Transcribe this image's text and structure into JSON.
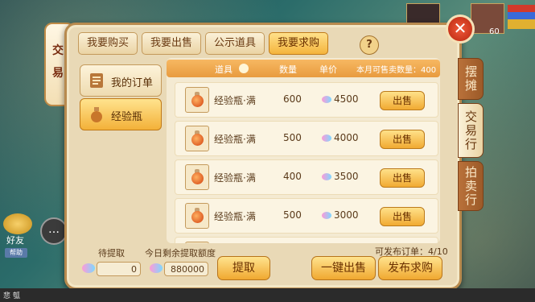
{
  "top_tabs": [
    {
      "label": "我要购买",
      "active": false
    },
    {
      "label": "我要出售",
      "active": false
    },
    {
      "label": "公示道具",
      "active": false
    },
    {
      "label": "我要求购",
      "active": true
    }
  ],
  "help_label": "?",
  "close_label": "✕",
  "side_menu": [
    {
      "label": "我的订单",
      "icon": "order-list-icon",
      "active": false
    },
    {
      "label": "经验瓶",
      "icon": "exp-bottle-icon",
      "active": true
    }
  ],
  "table": {
    "headers": {
      "item": "道具",
      "quantity": "数量",
      "price": "单价",
      "monthly_quota": "本月可售卖数量：400"
    },
    "rows": [
      {
        "name": "经验瓶·满",
        "quantity": "600",
        "price": "4500",
        "action": "出售"
      },
      {
        "name": "经验瓶·满",
        "quantity": "500",
        "price": "4000",
        "action": "出售"
      },
      {
        "name": "经验瓶·满",
        "quantity": "400",
        "price": "3500",
        "action": "出售"
      },
      {
        "name": "经验瓶·满",
        "quantity": "500",
        "price": "3000",
        "action": "出售"
      }
    ]
  },
  "bottom": {
    "pending_label": "待提取",
    "pending_value": "0",
    "daily_limit_label": "今日剩余提取额度",
    "daily_limit_value": "880000",
    "withdraw_button": "提取",
    "orders_info": "可发布订单：4/10",
    "sell_all_button": "一键出售",
    "publish_button": "发布求购"
  },
  "right_tabs": [
    {
      "label": "摆摊",
      "active": false
    },
    {
      "label": "交易行",
      "active": true
    },
    {
      "label": "拍卖行",
      "active": false
    }
  ],
  "left_banner": {
    "line1": "交",
    "line2": "易"
  },
  "hud": {
    "friend_label": "好友",
    "help_tag": "帮助",
    "level_value": "60"
  },
  "bottom_bar_text": "悲 瓠"
}
